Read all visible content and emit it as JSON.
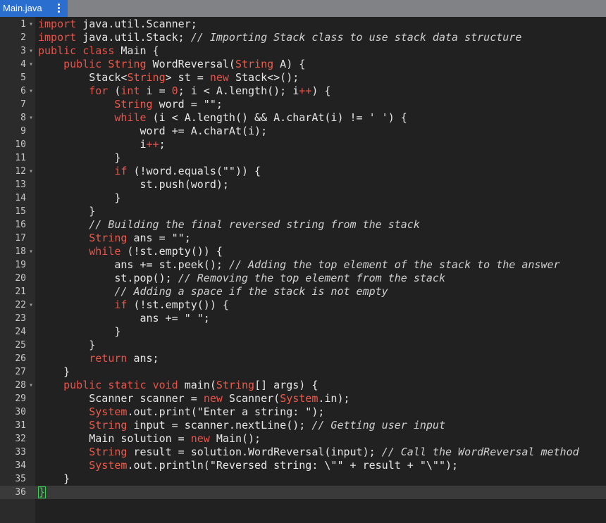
{
  "tab": {
    "title": "Main.java",
    "menu_icon": "kebab-menu-icon"
  },
  "colors": {
    "keyword": "#e8534a",
    "comment": "#cfcfcf",
    "text": "#e6e6e6",
    "editor_bg": "#212121",
    "tab_active": "#2a6fd0"
  },
  "lines": [
    {
      "n": "1",
      "fold": true,
      "segs": [
        [
          "k",
          "import"
        ],
        [
          "p",
          " java.util.Scanner;"
        ]
      ]
    },
    {
      "n": "2",
      "fold": false,
      "segs": [
        [
          "k",
          "import"
        ],
        [
          "p",
          " java.util.Stack; "
        ],
        [
          "c",
          "// Importing Stack class to use stack data structure"
        ]
      ]
    },
    {
      "n": "3",
      "fold": true,
      "segs": [
        [
          "k",
          "public"
        ],
        [
          "p",
          " "
        ],
        [
          "k",
          "class"
        ],
        [
          "p",
          " Main {"
        ]
      ]
    },
    {
      "n": "4",
      "fold": true,
      "segs": [
        [
          "p",
          "    "
        ],
        [
          "k",
          "public"
        ],
        [
          "p",
          " "
        ],
        [
          "t",
          "String"
        ],
        [
          "p",
          " WordReversal("
        ],
        [
          "t",
          "String"
        ],
        [
          "p",
          " A) {"
        ]
      ]
    },
    {
      "n": "5",
      "fold": false,
      "segs": [
        [
          "p",
          "        Stack<"
        ],
        [
          "t",
          "String"
        ],
        [
          "p",
          "> st = "
        ],
        [
          "k",
          "new"
        ],
        [
          "p",
          " Stack<>();"
        ]
      ]
    },
    {
      "n": "6",
      "fold": true,
      "segs": [
        [
          "p",
          "        "
        ],
        [
          "k",
          "for"
        ],
        [
          "p",
          " ("
        ],
        [
          "k",
          "int"
        ],
        [
          "p",
          " i = "
        ],
        [
          "k",
          "0"
        ],
        [
          "p",
          "; i < A.length(); i"
        ],
        [
          "k",
          "++"
        ],
        [
          "p",
          ") {"
        ]
      ]
    },
    {
      "n": "7",
      "fold": false,
      "segs": [
        [
          "p",
          "            "
        ],
        [
          "t",
          "String"
        ],
        [
          "p",
          " word = \"\";"
        ]
      ]
    },
    {
      "n": "8",
      "fold": true,
      "segs": [
        [
          "p",
          "            "
        ],
        [
          "k",
          "while"
        ],
        [
          "p",
          " (i < A.length() && A.charAt(i) != ' ') {"
        ]
      ]
    },
    {
      "n": "9",
      "fold": false,
      "segs": [
        [
          "p",
          "                word += A.charAt(i);"
        ]
      ]
    },
    {
      "n": "10",
      "fold": false,
      "segs": [
        [
          "p",
          "                i"
        ],
        [
          "k",
          "++"
        ],
        [
          "p",
          ";"
        ]
      ]
    },
    {
      "n": "11",
      "fold": false,
      "segs": [
        [
          "p",
          "            }"
        ]
      ]
    },
    {
      "n": "12",
      "fold": true,
      "segs": [
        [
          "p",
          "            "
        ],
        [
          "k",
          "if"
        ],
        [
          "p",
          " (!word.equals(\"\")) {"
        ]
      ]
    },
    {
      "n": "13",
      "fold": false,
      "segs": [
        [
          "p",
          "                st.push(word);"
        ]
      ]
    },
    {
      "n": "14",
      "fold": false,
      "segs": [
        [
          "p",
          "            }"
        ]
      ]
    },
    {
      "n": "15",
      "fold": false,
      "segs": [
        [
          "p",
          "        }"
        ]
      ]
    },
    {
      "n": "16",
      "fold": false,
      "segs": [
        [
          "p",
          "        "
        ],
        [
          "c",
          "// Building the final reversed string from the stack"
        ]
      ]
    },
    {
      "n": "17",
      "fold": false,
      "segs": [
        [
          "p",
          "        "
        ],
        [
          "t",
          "String"
        ],
        [
          "p",
          " ans = \"\";"
        ]
      ]
    },
    {
      "n": "18",
      "fold": true,
      "segs": [
        [
          "p",
          "        "
        ],
        [
          "k",
          "while"
        ],
        [
          "p",
          " (!st.empty()) {"
        ]
      ]
    },
    {
      "n": "19",
      "fold": false,
      "segs": [
        [
          "p",
          "            ans += st.peek(); "
        ],
        [
          "c",
          "// Adding the top element of the stack to the answer"
        ]
      ]
    },
    {
      "n": "20",
      "fold": false,
      "segs": [
        [
          "p",
          "            st.pop(); "
        ],
        [
          "c",
          "// Removing the top element from the stack"
        ]
      ]
    },
    {
      "n": "21",
      "fold": false,
      "segs": [
        [
          "p",
          "            "
        ],
        [
          "c",
          "// Adding a space if the stack is not empty"
        ]
      ]
    },
    {
      "n": "22",
      "fold": true,
      "segs": [
        [
          "p",
          "            "
        ],
        [
          "k",
          "if"
        ],
        [
          "p",
          " (!st.empty()) {"
        ]
      ]
    },
    {
      "n": "23",
      "fold": false,
      "segs": [
        [
          "p",
          "                ans += \" \";"
        ]
      ]
    },
    {
      "n": "24",
      "fold": false,
      "segs": [
        [
          "p",
          "            }"
        ]
      ]
    },
    {
      "n": "25",
      "fold": false,
      "segs": [
        [
          "p",
          "        }"
        ]
      ]
    },
    {
      "n": "26",
      "fold": false,
      "segs": [
        [
          "p",
          "        "
        ],
        [
          "k",
          "return"
        ],
        [
          "p",
          " ans;"
        ]
      ]
    },
    {
      "n": "27",
      "fold": false,
      "segs": [
        [
          "p",
          "    }"
        ]
      ]
    },
    {
      "n": "28",
      "fold": true,
      "segs": [
        [
          "p",
          "    "
        ],
        [
          "k",
          "public"
        ],
        [
          "p",
          " "
        ],
        [
          "k",
          "static"
        ],
        [
          "p",
          " "
        ],
        [
          "k",
          "void"
        ],
        [
          "p",
          " main("
        ],
        [
          "t",
          "String"
        ],
        [
          "p",
          "[] args) {"
        ]
      ]
    },
    {
      "n": "29",
      "fold": false,
      "segs": [
        [
          "p",
          "        Scanner scanner = "
        ],
        [
          "k",
          "new"
        ],
        [
          "p",
          " Scanner("
        ],
        [
          "t",
          "System"
        ],
        [
          "p",
          ".in);"
        ]
      ]
    },
    {
      "n": "30",
      "fold": false,
      "segs": [
        [
          "p",
          "        "
        ],
        [
          "t",
          "System"
        ],
        [
          "p",
          ".out.print(\"Enter a string: \");"
        ]
      ]
    },
    {
      "n": "31",
      "fold": false,
      "segs": [
        [
          "p",
          "        "
        ],
        [
          "t",
          "String"
        ],
        [
          "p",
          " input = scanner.nextLine(); "
        ],
        [
          "c",
          "// Getting user input"
        ]
      ]
    },
    {
      "n": "32",
      "fold": false,
      "segs": [
        [
          "p",
          "        Main solution = "
        ],
        [
          "k",
          "new"
        ],
        [
          "p",
          " Main();"
        ]
      ]
    },
    {
      "n": "33",
      "fold": false,
      "segs": [
        [
          "p",
          "        "
        ],
        [
          "t",
          "String"
        ],
        [
          "p",
          " result = solution.WordReversal(input); "
        ],
        [
          "c",
          "// Call the WordReversal method"
        ]
      ]
    },
    {
      "n": "34",
      "fold": false,
      "segs": [
        [
          "p",
          "        "
        ],
        [
          "t",
          "System"
        ],
        [
          "p",
          ".out.println(\"Reversed string: \\\"\" + result + \"\\\"\");"
        ]
      ]
    },
    {
      "n": "35",
      "fold": false,
      "segs": [
        [
          "p",
          "    }"
        ]
      ]
    },
    {
      "n": "36",
      "fold": false,
      "segs": [
        [
          "cur",
          "}"
        ]
      ]
    }
  ]
}
